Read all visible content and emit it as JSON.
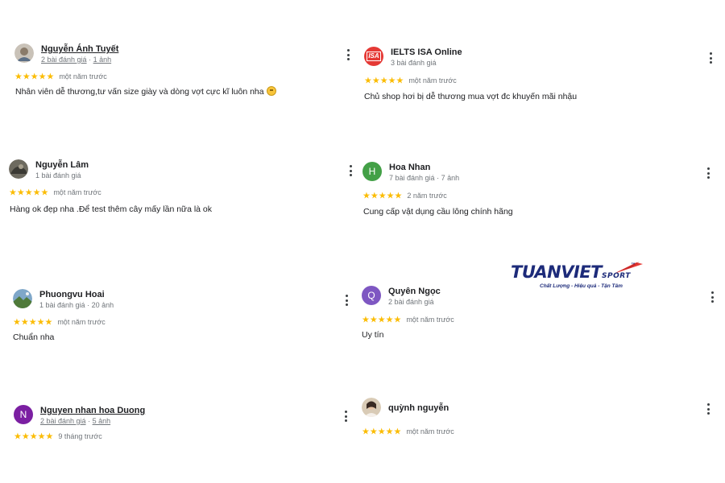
{
  "reviews": [
    {
      "name": "Nguyễn Ánh Tuyết",
      "reviews_count": "2 bài đánh giá",
      "photos": "1 ảnh",
      "stars": "★★★★★",
      "when": "một năm trước",
      "text": "Nhân viên dễ thương,tư vấn size giày và dòng vợt cực kĩ luôn nha"
    },
    {
      "name": "IELTS ISA Online",
      "reviews_count": "3 bài đánh giá",
      "stars": "★★★★★",
      "when": "một năm trước",
      "text": "Chủ shop hơi bị dễ thương mua vợt đc khuyến mãi nhậu",
      "avatar_label": "ISA"
    },
    {
      "name": "Nguyễn Lâm",
      "reviews_count": "1 bài đánh giá",
      "stars": "★★★★★",
      "when": "một năm trước",
      "text": "Hàng ok đẹp nha .Để test thêm cây mấy lần nữa là ok"
    },
    {
      "name": "Hoa Nhan",
      "reviews_count": "7 bài đánh giá",
      "photos": "7 ảnh",
      "stars": "★★★★★",
      "when": "2 năm trước",
      "text": "Cung cấp vật dụng cầu lông chính hãng",
      "avatar_letter": "H"
    },
    {
      "name": "Phuongvu Hoai",
      "reviews_count": "1 bài đánh giá",
      "photos": "20 ảnh",
      "stars": "★★★★★",
      "when": "một năm trước",
      "text": "Chuẩn nha"
    },
    {
      "name": "Quyên Ngọc",
      "reviews_count": "2 bài đánh giá",
      "stars": "★★★★★",
      "when": "một năm trước",
      "text": "Uy tín",
      "avatar_letter": "Q"
    },
    {
      "name": "Nguyen nhan hoa Duong",
      "reviews_count": "2 bài đánh giá",
      "photos": "5 ảnh",
      "stars": "★★★★★",
      "when": "9 tháng trước",
      "text": "",
      "avatar_letter": "N"
    },
    {
      "name": "quỳnh nguyễn",
      "stars": "★★★★★",
      "when": "một năm trước",
      "text": ""
    }
  ],
  "meta_separator": "·",
  "logo": {
    "brand": "TUANVIET",
    "sport": "SPORT",
    "tm": "™",
    "tagline": "Chất Lượng - Hiệu quả - Tận Tâm"
  },
  "colors": {
    "star": "#fbbc04",
    "avatar_h": "#43a047",
    "avatar_q": "#7e57c2",
    "avatar_n": "#7b1fa2",
    "avatar_isa": "#e53935",
    "brand_blue": "#1d2b7a",
    "brand_red": "#e53935"
  }
}
